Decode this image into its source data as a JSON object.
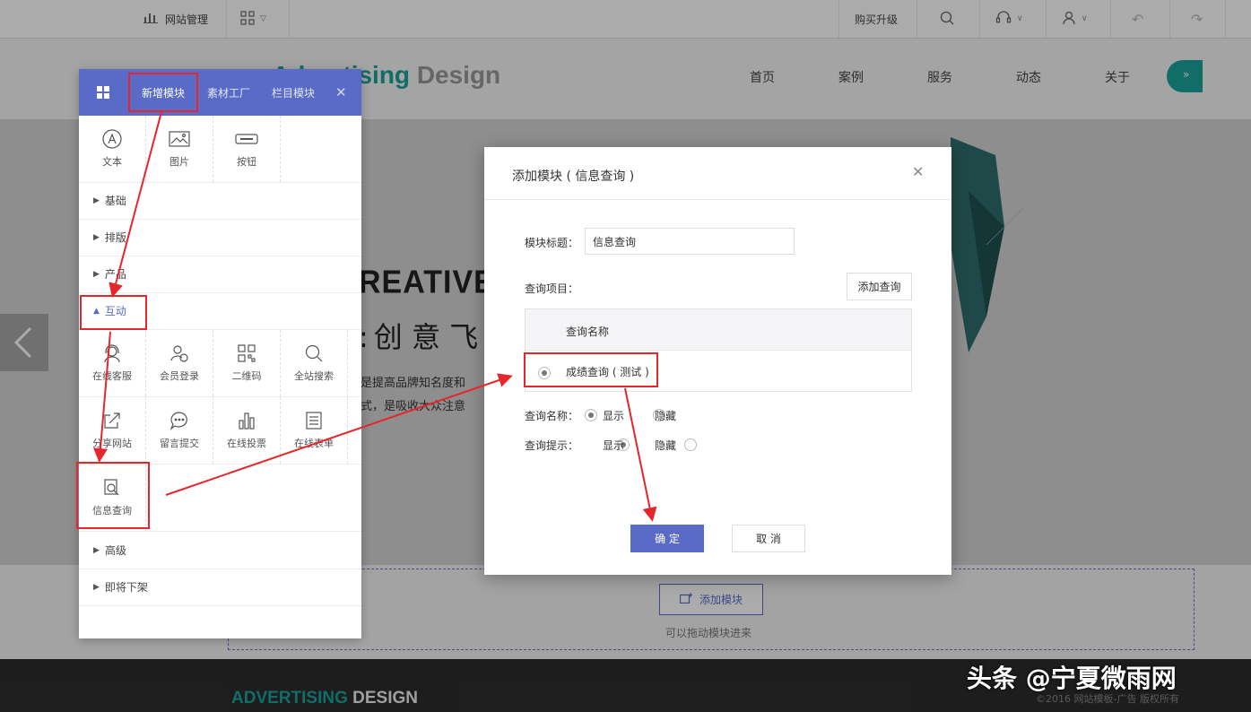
{
  "toolbar": {
    "site_manage": "网站管理",
    "upgrade": "购买升级"
  },
  "site": {
    "logo_word1": "Advertising",
    "logo_word2": "Design",
    "nav": [
      "首页",
      "案例",
      "服务",
      "动态",
      "关于"
    ],
    "banner_big": "REATIVE",
    "banner_cn": "创 意 飞",
    "banner_line1": "是提高品牌知名度和",
    "banner_line2": "式，是吸收大众注意",
    "add_module_btn": "添加模块",
    "drag_hint": "可以拖动模块进来",
    "footer_logo1": "ADVERTISING",
    "footer_logo2": "DESIGN",
    "copyright": "©2016 网站模板-广告 版权所有"
  },
  "panel": {
    "tabs": [
      "新增模块",
      "素材工厂",
      "栏目模块"
    ],
    "basic_items": [
      {
        "label": "文本",
        "icon": "text-icon"
      },
      {
        "label": "图片",
        "icon": "image-icon"
      },
      {
        "label": "按钮",
        "icon": "button-icon"
      }
    ],
    "categories": {
      "basic": "基础",
      "layout": "排版",
      "product": "产品",
      "interact": "互动",
      "advanced": "高级",
      "offline": "即将下架"
    },
    "interact_items": [
      {
        "label": "在线客服",
        "icon": "headset-icon"
      },
      {
        "label": "会员登录",
        "icon": "member-icon"
      },
      {
        "label": "二维码",
        "icon": "qrcode-icon"
      },
      {
        "label": "全站搜索",
        "icon": "search-icon"
      },
      {
        "label": "分享网站",
        "icon": "share-icon"
      },
      {
        "label": "留言提交",
        "icon": "chat-icon"
      },
      {
        "label": "在线投票",
        "icon": "vote-icon"
      },
      {
        "label": "在线表单",
        "icon": "form-icon"
      },
      {
        "label": "信息查询",
        "icon": "info-query-icon"
      }
    ]
  },
  "dialog": {
    "title": "添加模块 ( 信息查询 )",
    "module_title_label": "模块标题：",
    "module_title_value": "信息查询",
    "query_items_label": "查询项目：",
    "add_query": "添加查询",
    "table_header": "查询名称",
    "table_row": "成绩查询 ( 测试 )",
    "name_label": "查询名称：",
    "tip_label": "查询提示：",
    "show": "显示",
    "hide": "隐藏",
    "ok": "确 定",
    "cancel": "取 消"
  },
  "watermark": "头条 @宁夏微雨网",
  "colors": {
    "accent": "#5a6bc7",
    "teal": "#1aa39a",
    "annotation": "#e5262b"
  }
}
